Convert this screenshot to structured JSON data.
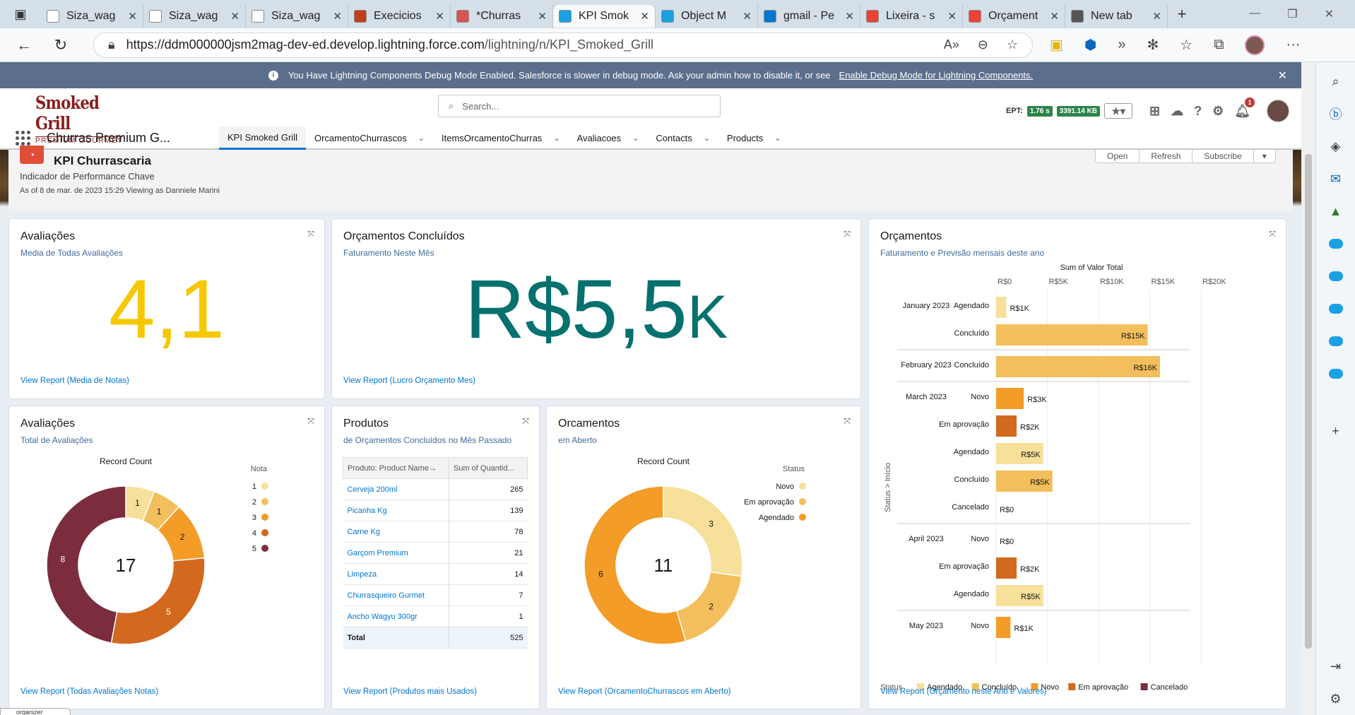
{
  "browser": {
    "tabs": [
      {
        "title": "Siza_wag",
        "fav": "doc-icon",
        "color": "#ffffff"
      },
      {
        "title": "Siza_wag",
        "fav": "doc-icon",
        "color": "#ffffff"
      },
      {
        "title": "Siza_wag",
        "fav": "doc-icon",
        "color": "#ffffff"
      },
      {
        "title": "Execicios",
        "fav": "powerpoint-icon",
        "color": "#c43e1c"
      },
      {
        "title": "*Churras",
        "fav": "pdf-icon",
        "color": "#d9534f"
      },
      {
        "title": "KPI Smok",
        "fav": "salesforce-icon",
        "color": "#1ba1e2",
        "active": true
      },
      {
        "title": "Object M",
        "fav": "salesforce-icon",
        "color": "#1ba1e2"
      },
      {
        "title": "gmail - Pe",
        "fav": "search-icon",
        "color": "#0078d4"
      },
      {
        "title": "Lixeira - s",
        "fav": "gmail-icon",
        "color": "#ea4335"
      },
      {
        "title": "Orçament",
        "fav": "gmail-icon",
        "color": "#ea4335"
      },
      {
        "title": "New tab",
        "fav": "newtab-icon",
        "color": "#555555"
      }
    ],
    "url_host": "https://ddm000000jsm2mag-dev-ed.develop.lightning.force.com",
    "url_path": "/lightning/n/KPI_Smoked_Grill"
  },
  "debug_banner": {
    "text": "You Have Lightning Components Debug Mode Enabled. Salesforce is slower in debug mode. Ask your admin how to disable it, or see",
    "link": "Enable Debug Mode for Lightning Components."
  },
  "header": {
    "logo_line1": "Smoked Grill",
    "logo_line2": "PREMIUM GOURMET",
    "search_placeholder": "Search...",
    "ept_label": "EPT:",
    "ept_time": "1.76 s",
    "ept_size": "3391.14 KB",
    "notification_count": "1"
  },
  "app_nav": {
    "app_name": "Churras Premium G...",
    "items": [
      {
        "label": "KPI Smoked Grill",
        "active": true,
        "dropdown": false
      },
      {
        "label": "OrcamentoChurrascos",
        "dropdown": true
      },
      {
        "label": "ItemsOrcamentoChurras",
        "dropdown": true
      },
      {
        "label": "Avaliacoes",
        "dropdown": true
      },
      {
        "label": "Contacts",
        "dropdown": true
      },
      {
        "label": "Products",
        "dropdown": true
      }
    ]
  },
  "page": {
    "title": "KPI Churrascaria",
    "subtitle": "Indicador de Performance Chave",
    "as_of": "As of 8 de mar. de 2023 15:29 Viewing as Danniele Marini",
    "buttons": {
      "open": "Open",
      "refresh": "Refresh",
      "subscribe": "Subscribe"
    }
  },
  "cards": {
    "avaliacoes_media": {
      "title": "Avaliações",
      "subtitle": "Media de Todas Avaliações",
      "metric": "4,1",
      "metric_color": "#f5c800",
      "link": "View Report (Media de Notas)"
    },
    "orcamentos_concluidos": {
      "title": "Orçamentos Concluídos",
      "subtitle": "Faturamento Neste Mês",
      "metric": "R$5,5",
      "metric_suffix": "K",
      "metric_color": "#04716e",
      "link": "View Report (Lucro Orçamento Mes)"
    },
    "orcamentos_faturamento": {
      "title": "Orçamentos",
      "subtitle": "Faturamento e Previsão mensais deste ano",
      "link": "View Report (Orçamento neste Ano e Valores)"
    },
    "avaliacoes_total": {
      "title": "Avaliações",
      "subtitle": "Total de Avaliações",
      "link": "View Report (Todas Avaliações Notas)"
    },
    "produtos": {
      "title": "Produtos",
      "subtitle": "de Orçamentos Concluídos no Mês Passado",
      "col1": "Produto: Product Name",
      "col2": "Sum of Quantid...",
      "rows": [
        {
          "name": "Cerveja 200ml",
          "qty": "265"
        },
        {
          "name": "Picanha Kg",
          "qty": "139"
        },
        {
          "name": "Carne Kg",
          "qty": "78"
        },
        {
          "name": "Garçom Premium",
          "qty": "21"
        },
        {
          "name": "Limpeza",
          "qty": "14"
        },
        {
          "name": "Churrasqueiro Gurmet",
          "qty": "7"
        },
        {
          "name": "Ancho Wagyu 300gr",
          "qty": "1"
        }
      ],
      "total_label": "Total",
      "total_value": "525",
      "link": "View Report (Produtos mais Usados)"
    },
    "orcamentos_aberto": {
      "title": "Orcamentos",
      "subtitle": "em Aberto",
      "link": "View Report (OrcamentoChurrascos em Aberto)"
    }
  },
  "chart_data": [
    {
      "type": "donut",
      "title": "Record Count",
      "legend_title": "Nota",
      "legend_position": "right",
      "center_label": "17",
      "categories": [
        "1",
        "2",
        "3",
        "4",
        "5"
      ],
      "values": [
        1,
        1,
        2,
        5,
        8
      ],
      "colors": [
        "#f6e09a",
        "#f3bf5c",
        "#f39c27",
        "#d2691e",
        "#7b2d3e"
      ]
    },
    {
      "type": "donut",
      "title": "Record Count",
      "legend_title": "Status",
      "legend_position": "right",
      "center_label": "11",
      "categories": [
        "Novo",
        "Em aprovação",
        "Agendado"
      ],
      "values": [
        3,
        2,
        6
      ],
      "colors": [
        "#f6e09a",
        "#f3bf5c",
        "#f39c27"
      ]
    },
    {
      "type": "bar",
      "orientation": "horizontal",
      "title": "Sum of Valor Total",
      "ylabel": "Status > Início",
      "legend_title": "Status",
      "legend_position": "bottom",
      "x_ticks": [
        "R$0",
        "R$5K",
        "R$10K",
        "R$15K",
        "R$20K"
      ],
      "xlim": [
        0,
        20000
      ],
      "status_colors": {
        "Agendado": "#f6e09a",
        "Concluído": "#f3bf5c",
        "Novo": "#f39c27",
        "Em aprovação": "#d2691e",
        "Cancelado": "#7b2d3e"
      },
      "legend": [
        "Agendado",
        "Concluído",
        "Novo",
        "Em aprovação",
        "Cancelado"
      ],
      "groups": [
        {
          "month": "January 2023",
          "rows": [
            {
              "status": "Agendado",
              "value": 1000,
              "label": "R$1K"
            },
            {
              "status": "Concluído",
              "value": 14800,
              "label": "R$15K"
            }
          ]
        },
        {
          "month": "February 2023",
          "rows": [
            {
              "status": "Concluído",
              "value": 16000,
              "label": "R$16K"
            }
          ]
        },
        {
          "month": "March 2023",
          "rows": [
            {
              "status": "Novo",
              "value": 2700,
              "label": "R$3K"
            },
            {
              "status": "Em aprovação",
              "value": 2000,
              "label": "R$2K"
            },
            {
              "status": "Agendado",
              "value": 4600,
              "label": "R$5K"
            },
            {
              "status": "Concluído",
              "value": 5500,
              "label": "R$5K"
            },
            {
              "status": "Cancelado",
              "value": 0,
              "label": "R$0"
            }
          ]
        },
        {
          "month": "April 2023",
          "rows": [
            {
              "status": "Novo",
              "value": 0,
              "label": "R$0"
            },
            {
              "status": "Em aprovação",
              "value": 2000,
              "label": "R$2K"
            },
            {
              "status": "Agendado",
              "value": 4600,
              "label": "R$5K"
            }
          ]
        },
        {
          "month": "May 2023",
          "rows": [
            {
              "status": "Novo",
              "value": 1400,
              "label": "R$1K"
            }
          ]
        }
      ]
    }
  ],
  "footer": {
    "organizer": "organizer"
  }
}
